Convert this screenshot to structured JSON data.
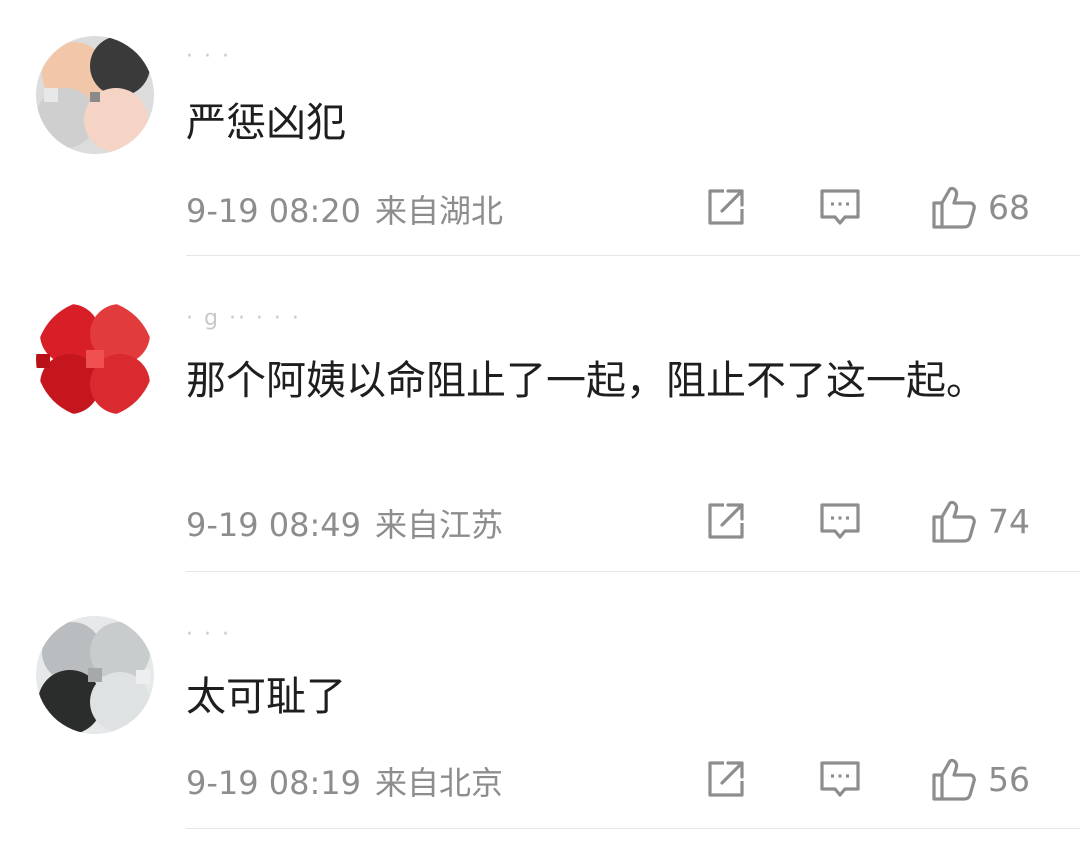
{
  "comments": [
    {
      "username": "·  ·  ·",
      "text": "严惩凶犯",
      "date": "9-19 08:20",
      "location": "来自湖北",
      "likes": "68",
      "avatar_colors": [
        "#f2c6a8",
        "#3a3a3a",
        "#cfcfcf",
        "#f5d4c6",
        "#8a8a8a",
        "#e8e8e8"
      ]
    },
    {
      "username": "· g ·· · · ·",
      "text": "那个阿姨以命阻止了一起，阻止不了这一起。",
      "date": "9-19 08:49",
      "location": "来自江苏",
      "likes": "74",
      "avatar_colors": [
        "#d81e26",
        "#e23b3b",
        "#c4161c",
        "#d92a2f",
        "#f05050",
        "#b81218"
      ]
    },
    {
      "username": "·  ·  ·",
      "text": "太可耻了",
      "date": "9-19 08:19",
      "location": "来自北京",
      "likes": "56",
      "avatar_colors": [
        "#b9bdbf",
        "#c8cccd",
        "#2a2d2c",
        "#dfe2e3",
        "#a5a9aa",
        "#eceeef"
      ]
    }
  ],
  "icons": {
    "share": "share-icon",
    "reply": "comment-icon",
    "like": "thumbs-up-icon"
  },
  "colors": {
    "text": "#1e1e1e",
    "meta": "#8d8d8d",
    "icon": "#8d8d8d",
    "divider": "#e6e6e6"
  }
}
